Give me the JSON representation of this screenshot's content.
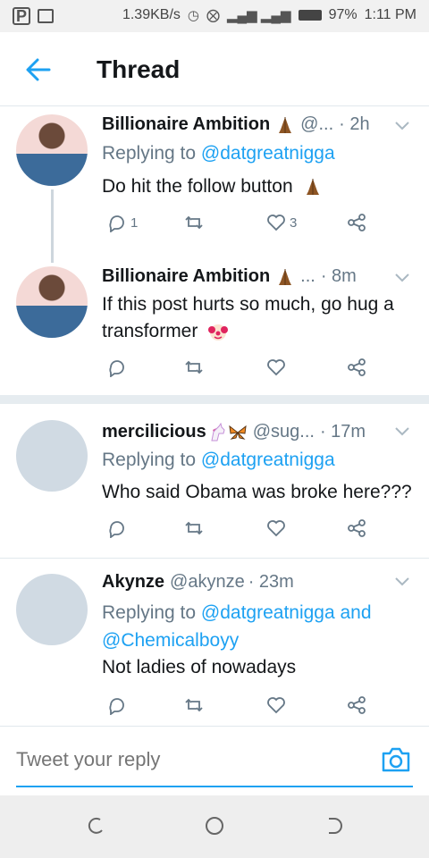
{
  "status_bar": {
    "speed": "1.39KB/s",
    "battery": "97%",
    "time": "1:11 PM"
  },
  "header": {
    "title": "Thread"
  },
  "tweets": [
    {
      "name": "Billionaire Ambition",
      "handle": "@...",
      "time": "· 2h",
      "replying_label": "Replying to",
      "mentions": "@datgreatnigga",
      "text": "Do hit the follow button",
      "reply_count": "1",
      "like_count": "3"
    },
    {
      "name": "Billionaire Ambition",
      "handle": "...",
      "time": "· 8m",
      "text": "If this post hurts so much, go hug a transformer",
      "reply_count": "",
      "like_count": ""
    },
    {
      "name": "mercilicious",
      "handle": "@sug...",
      "time": "· 17m",
      "replying_label": "Replying to",
      "mentions": "@datgreatnigga",
      "text": "Who said Obama was broke here???"
    },
    {
      "name": "Akynze",
      "handle": "@akynze",
      "time": "· 23m",
      "replying_label": "Replying to",
      "mentions": "@datgreatnigga and @Chemicalboyy",
      "text": "Not ladies of nowadays"
    }
  ],
  "reply_box": {
    "placeholder": "Tweet your reply"
  },
  "colors": {
    "accent": "#1da1f2",
    "muted": "#657786",
    "text": "#14171a"
  },
  "icons": [
    "back-arrow-icon",
    "chevron-down-icon",
    "reply-icon",
    "retweet-icon",
    "like-icon",
    "share-icon",
    "camera-icon",
    "folded-hands-emoji",
    "clown-emoji",
    "unicorn-emoji",
    "butterfly-emoji"
  ]
}
